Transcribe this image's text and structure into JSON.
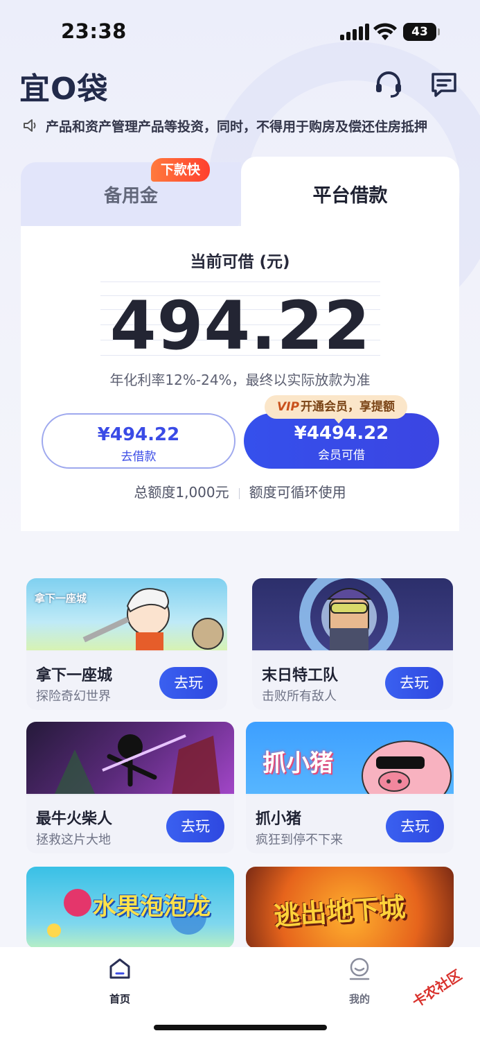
{
  "status": {
    "time": "23:38",
    "battery": "43"
  },
  "header": {
    "logo": "宜O袋"
  },
  "notice": {
    "text": "产品和资产管理产品等投资，同时，不得用于购房及偿还住房抵押"
  },
  "tabs": [
    {
      "label": "备用金",
      "badge": "下款快",
      "active": false
    },
    {
      "label": "平台借款",
      "active": true
    }
  ],
  "loan": {
    "available_title": "当前可借 (元)",
    "amount": "494.22",
    "rate_note": "年化利率12%-24%，最终以实际放款为准",
    "borrow_button": {
      "amount": "¥494.22",
      "label": "去借款"
    },
    "vip_button": {
      "amount": "¥4494.22",
      "label": "会员可借"
    },
    "vip_tip": {
      "badge": "VIP",
      "text": "开通会员，享提额"
    },
    "quota_total": "总额度1,000元",
    "quota_note": "额度可循环使用"
  },
  "games": [
    {
      "art_title": "拿下一座城",
      "name": "拿下一座城",
      "desc": "探险奇幻世界",
      "button": "去玩"
    },
    {
      "art_title": "",
      "name": "末日特工队",
      "desc": "击败所有敌人",
      "button": "去玩"
    },
    {
      "art_title": "",
      "name": "最牛火柴人",
      "desc": "拯救这片大地",
      "button": "去玩"
    },
    {
      "art_title": "抓小猪",
      "name": "抓小猪",
      "desc": "疯狂到停不下来",
      "button": "去玩"
    },
    {
      "art_title": "水果泡泡龙",
      "name": "",
      "desc": "",
      "button": ""
    },
    {
      "art_title": "逃出地下城",
      "name": "",
      "desc": "",
      "button": ""
    }
  ],
  "nav": [
    {
      "label": "首页",
      "icon": "home-icon",
      "active": true
    },
    {
      "label": "我的",
      "icon": "profile-icon",
      "active": false
    }
  ],
  "watermark": "卡农社区",
  "colors": {
    "primary": "#3a4be6",
    "badge": "#ff4f2e",
    "vip_tip_bg": "#fbe6c9"
  }
}
